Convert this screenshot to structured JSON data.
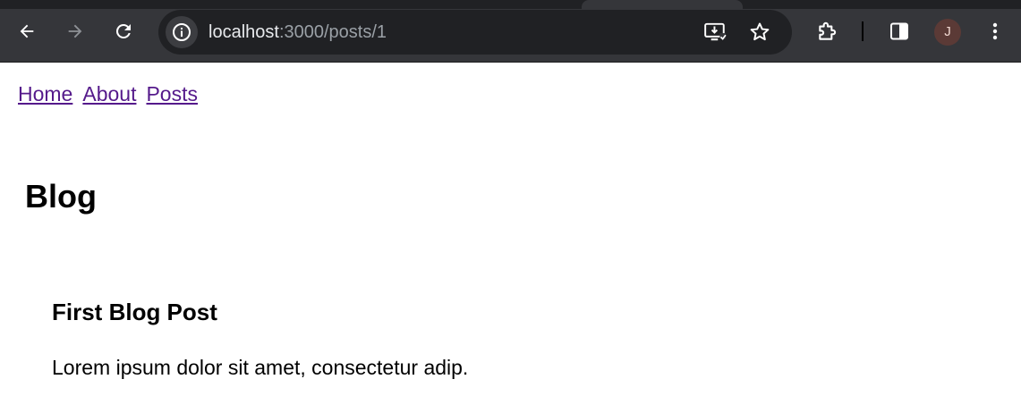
{
  "browser": {
    "url_host": "localhost",
    "url_path": ":3000/posts/1",
    "icons": {
      "back": "arrow-left-icon",
      "forward": "arrow-right-icon",
      "reload": "reload-icon",
      "site_info": "info-icon",
      "install": "install-app-icon",
      "bookmark": "star-icon",
      "extensions": "puzzle-icon",
      "side_panel": "side-panel-icon",
      "menu": "kebab-menu-icon"
    },
    "profile_initial": "J",
    "colors": {
      "toolbar": "#35363a",
      "omnibox": "#202124",
      "avatar": "#5b3a36"
    }
  },
  "nav": {
    "links": [
      "Home",
      "About",
      "Posts"
    ],
    "link_color": "#551a8b"
  },
  "main": {
    "heading": "Blog",
    "post": {
      "title": "First Blog Post",
      "body": "Lorem ipsum dolor sit amet, consectetur adip."
    }
  }
}
